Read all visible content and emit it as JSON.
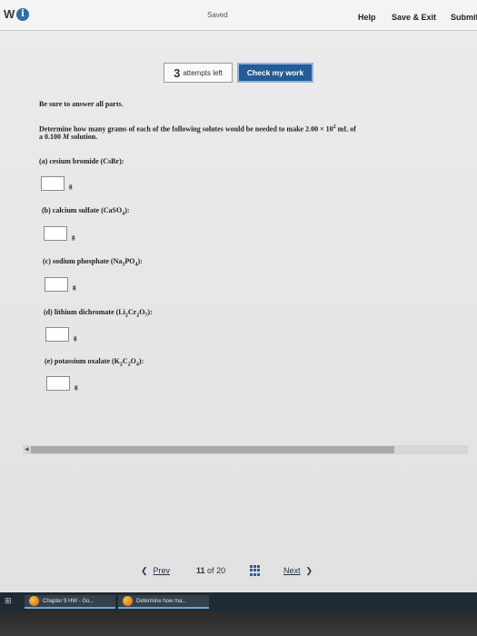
{
  "topbar": {
    "brand": "W",
    "info_icon": "info-icon",
    "saved": "Saved",
    "help": "Help",
    "save_exit": "Save & Exit",
    "submit": "Submit"
  },
  "attempts": {
    "count": "3",
    "label": "attempts left"
  },
  "check_work": "Check my work",
  "question": {
    "be_sure": "Be sure to answer all parts.",
    "prompt_a": "Determine how many grams of each of the following solutes would be needed to make 2.00 × 10",
    "prompt_exp": "2",
    "prompt_b": " mL of",
    "prompt_line2_a": "a 0.100 ",
    "prompt_line2_M": "M",
    "prompt_line2_b": " solution.",
    "parts": [
      {
        "label": "(a) cesium bromide (CsBr):",
        "unit": "g",
        "value": ""
      },
      {
        "label_a": "(b) calcium sulfate (CaSO",
        "sub1": "4",
        "label_b": "):",
        "unit": "g",
        "value": ""
      },
      {
        "label_a": "(c) sodium phosphate (Na",
        "sub1": "3",
        "label_m": "PO",
        "sub2": "4",
        "label_b": "):",
        "unit": "g",
        "value": ""
      },
      {
        "label_a": "(d) lithium dichromate (Li",
        "sub1": "2",
        "label_m": "Cr",
        "sub2": "2",
        "label_m2": "O",
        "sub3": "7",
        "label_b": "):",
        "unit": "g",
        "value": ""
      },
      {
        "label_a": "(e) potassium oxalate (K",
        "sub1": "2",
        "label_m": "C",
        "sub2": "2",
        "label_m2": "O",
        "sub3": "4",
        "label_b": "):",
        "unit": "g",
        "value": ""
      }
    ]
  },
  "nav": {
    "prev": "Prev",
    "current": "11",
    "of": "of",
    "total": "20",
    "next": "Next"
  },
  "taskbar": {
    "tasks": [
      {
        "label": "Chapter 9 HW - Go..."
      },
      {
        "label": "Determine how ma..."
      }
    ]
  }
}
